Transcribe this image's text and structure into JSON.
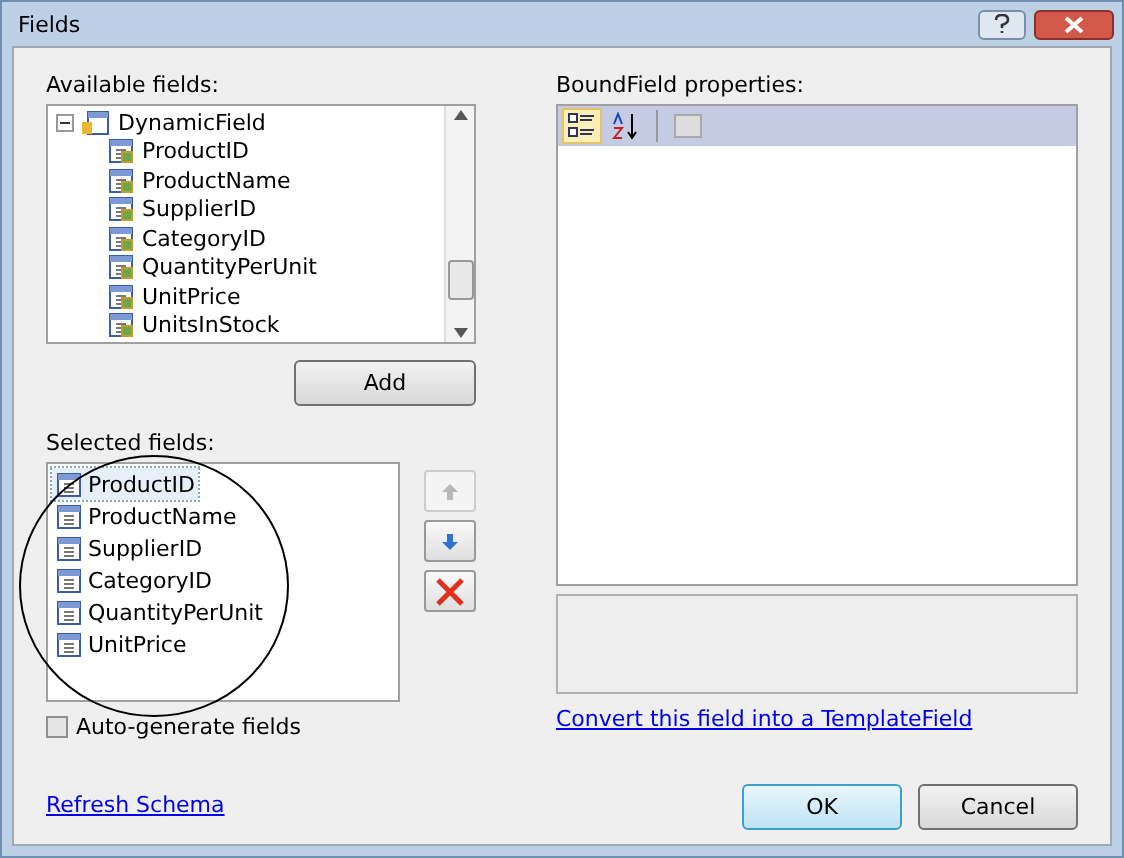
{
  "window": {
    "title": "Fields"
  },
  "available_fields": {
    "label": "Available fields:",
    "tree": [
      {
        "label": "DynamicField",
        "expanded": true,
        "children": [
          {
            "label": "ProductID"
          },
          {
            "label": "ProductName"
          },
          {
            "label": "SupplierID"
          },
          {
            "label": "CategoryID"
          },
          {
            "label": "QuantityPerUnit"
          },
          {
            "label": "UnitPrice"
          },
          {
            "label": "UnitsInStock"
          }
        ]
      }
    ],
    "add_button": "Add"
  },
  "selected_fields": {
    "label": "Selected fields:",
    "items": [
      {
        "label": "ProductID",
        "selected": true
      },
      {
        "label": "ProductName",
        "selected": false
      },
      {
        "label": "SupplierID",
        "selected": false
      },
      {
        "label": "CategoryID",
        "selected": false
      },
      {
        "label": "QuantityPerUnit",
        "selected": false
      },
      {
        "label": "UnitPrice",
        "selected": false
      }
    ],
    "side_buttons": [
      {
        "kind": "up",
        "disabled": true
      },
      {
        "kind": "down",
        "disabled": false
      },
      {
        "kind": "delete",
        "disabled": false
      }
    ]
  },
  "auto_generate": {
    "label": "Auto-generate fields",
    "checked": false
  },
  "refresh_link": "Refresh Schema",
  "properties": {
    "label": "BoundField properties:",
    "categorized_selected": true
  },
  "convert_link": "Convert this field into a TemplateField",
  "buttons": [
    {
      "label": "OK",
      "default": true
    },
    {
      "label": "Cancel",
      "default": false
    }
  ]
}
